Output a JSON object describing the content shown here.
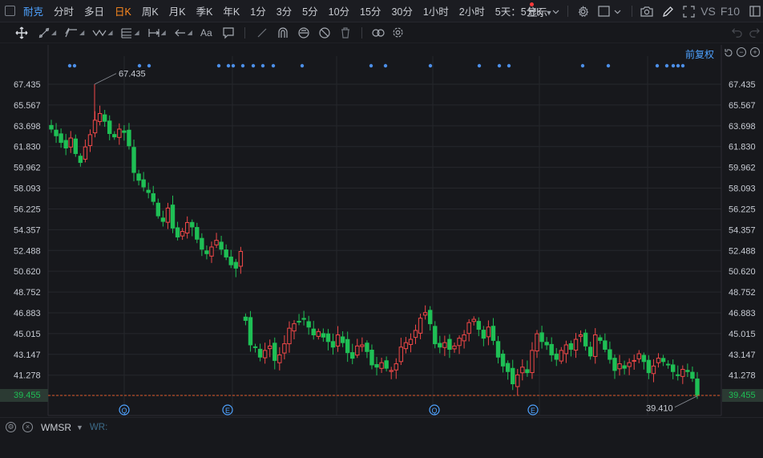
{
  "topbar": {
    "stock_name": "耐克",
    "periods": [
      "分时",
      "多日",
      "日K",
      "周K",
      "月K",
      "季K",
      "年K",
      "1分",
      "3分",
      "5分",
      "10分",
      "15分",
      "30分",
      "1小时",
      "2小时",
      "5天：5分K"
    ],
    "active_period": "日K",
    "right": {
      "display_label": "显示",
      "vs_label": "VS",
      "f10_label": "F10"
    }
  },
  "toolbar": {
    "text_tool_label": "Aa"
  },
  "chart": {
    "adjust_label": "前复权",
    "high_label": "67.435",
    "low_label": "39.410",
    "last_price": "39.455",
    "event_markers": [
      "Q",
      "E",
      "Q",
      "E"
    ],
    "colors": {
      "up": "#f04848",
      "down": "#1fbf55",
      "grid": "#26272c",
      "dot": "#4c8fe8",
      "price_line": "#e05a2b"
    }
  },
  "chart_data": {
    "type": "candlestick",
    "title": "",
    "xlabel": "",
    "ylabel": "",
    "ylim": [
      38.6,
      68.8
    ],
    "y_ticks": [
      "67.435",
      "65.567",
      "63.698",
      "61.830",
      "59.962",
      "58.093",
      "56.225",
      "54.357",
      "52.488",
      "50.620",
      "48.752",
      "46.883",
      "45.015",
      "43.147",
      "41.278",
      "39.455"
    ],
    "grid": true,
    "annotations": [
      {
        "label": "67.435",
        "type": "period high"
      },
      {
        "label": "39.410",
        "type": "period low"
      }
    ],
    "closes": [
      63.4,
      62.8,
      62.2,
      61.7,
      62.6,
      61.2,
      60.4,
      61.8,
      62.9,
      64.2,
      64.8,
      64.1,
      63.0,
      62.7,
      63.4,
      63.1,
      61.9,
      59.5,
      58.8,
      58.2,
      57.7,
      56.9,
      55.6,
      55.1,
      56.3,
      54.5,
      53.7,
      54.2,
      55.0,
      54.6,
      53.5,
      52.6,
      52.2,
      52.8,
      53.4,
      52.6,
      51.9,
      51.2,
      50.9,
      52.4,
      46.2,
      44.0,
      43.8,
      42.9,
      43.5,
      43.9,
      42.6,
      43.1,
      44.1,
      45.5,
      45.9,
      46.1,
      46.3,
      45.6,
      44.9,
      45.2,
      44.7,
      44.3,
      43.8,
      44.9,
      44.2,
      43.3,
      42.8,
      43.9,
      44.0,
      43.4,
      42.2,
      42.0,
      42.4,
      41.9,
      41.7,
      42.3,
      43.8,
      44.2,
      44.5,
      45.3,
      46.4,
      46.9,
      45.9,
      44.1,
      43.8,
      44.2,
      43.6,
      43.9,
      44.6,
      44.9,
      46.0,
      46.3,
      45.4,
      44.6,
      45.6,
      44.4,
      42.9,
      42.1,
      41.6,
      40.5,
      41.3,
      42.0,
      41.5,
      43.5,
      45.0,
      44.3,
      44.0,
      43.1,
      42.7,
      43.5,
      44.0,
      43.6,
      44.5,
      44.9,
      43.9,
      43.0,
      44.9,
      44.4,
      43.6,
      42.7,
      41.7,
      42.3,
      41.9,
      42.4,
      42.6,
      43.2,
      42.5,
      41.5,
      42.1,
      42.8,
      42.5,
      42.2,
      41.6,
      41.3,
      41.8,
      41.6,
      41.0,
      39.455
    ]
  },
  "indicator_bar": {
    "name": "WMSR",
    "sub_label": "WR:"
  }
}
